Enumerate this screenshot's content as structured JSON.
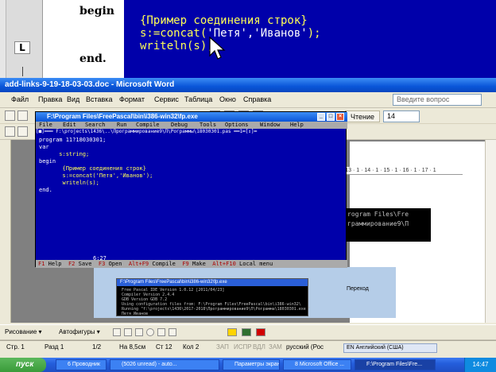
{
  "top_editor": {
    "line_begin": "begin",
    "line_comment": "{Пример соединения строк}",
    "line_concat_prefix": "s:=concat(",
    "line_concat_args": "'Петя','Иванов'",
    "line_concat_suffix": ");",
    "line_writeln": "writeln(s);",
    "line_end": "end.",
    "ruler_mark": "L"
  },
  "word": {
    "title": "add-links-9-19-18-03-03.doc - Microsoft Word",
    "menu": [
      "Файл",
      "Правка",
      "Вид",
      "Вставка",
      "Формат",
      "Сервис",
      "Таблица",
      "Окно",
      "Справка"
    ],
    "ask_placeholder": "Введите вопрос",
    "reading_button": "Чтение",
    "font_size": "14",
    "ruler_text": "· 13 · 1 · 14 · 1 · 15 · 1 · 16 · 1 · 17 · 1",
    "black_strip_lines": [
      "rogram Files\\Fre",
      "граммирование9\\П"
    ],
    "draw_bar": {
      "drawing_label": "Рисование ▾",
      "autoshapes_label": "Автофигуры ▾"
    },
    "status": {
      "page": "Стр. 1",
      "section": "Разд 1",
      "pages": "1/2",
      "at": "На 8,5см",
      "line": "Ст 12",
      "col": "Кол 2",
      "rec": "ЗАП",
      "trk": "ИСПР",
      "ext": "ВДЛ",
      "ovr": "ЗАМ",
      "language": "русский (Рос"
    },
    "lang_indicator": "EN Английский (США)",
    "thumbnail": {
      "title": "F:\\Program Files\\FreePascal\\bin\\i386-win32\\fp.exe",
      "lines": [
        "Free Pascal IDE Version 1.0.12 [2011/04/23]",
        "Compiler Version 2.4.4",
        "GDB Version GDB 7.2",
        "Using configuration files from: F:\\Program Files\\FreePascal\\bin\\i386-win32\\",
        "Running \"f:\\projects\\1436\\2017-2018\\Программирование9\\П\\Рограмма\\18030301.exe \"",
        "Петя Иванов"
      ],
      "nav_label": "Переход"
    }
  },
  "fp_ide": {
    "title": "F:\\Program Files\\FreePascal\\bin\\i386-win32\\fp.exe",
    "menu": [
      "File",
      "Edit",
      "Search",
      "Run",
      "Compile",
      "Debug",
      "Tools",
      "Options",
      "Window",
      "Help"
    ],
    "edit_title": "[■]═══ F:\\projects\\1436\\..\\Программирование9\\П\\Рограммы\\18030301.pas ══1═[↕]═",
    "code": [
      "program 11?18030301;",
      "var",
      "      s:string;",
      "begin",
      "       {Пример соединения строк}",
      "       s:=concat('Петя','Иванов');",
      "       writeln(s);",
      "end."
    ],
    "cursor_pos": "6:27",
    "status_keys": [
      {
        "key": "F1",
        "label": "Help"
      },
      {
        "key": "F2",
        "label": "Save"
      },
      {
        "key": "F3",
        "label": "Open"
      },
      {
        "key": "Alt+F9",
        "label": "Compile"
      },
      {
        "key": "F9",
        "label": "Make"
      },
      {
        "key": "Alt+F10",
        "label": "Local menu"
      }
    ]
  },
  "taskbar": {
    "start_label": "пуск",
    "tasks": [
      "6 Проводник",
      "(5026 unread) - auto...",
      "Параметры экранно...",
      "8 Microsoft Office ...",
      "F:\\Program Files\\Fre..."
    ],
    "clock": "14:47"
  },
  "colors": {
    "ide_blue": "#0000aa",
    "code_yellow": "#ffff55",
    "xp_title_blue": "#0a55d8",
    "start_green": "#3a9b3a"
  }
}
